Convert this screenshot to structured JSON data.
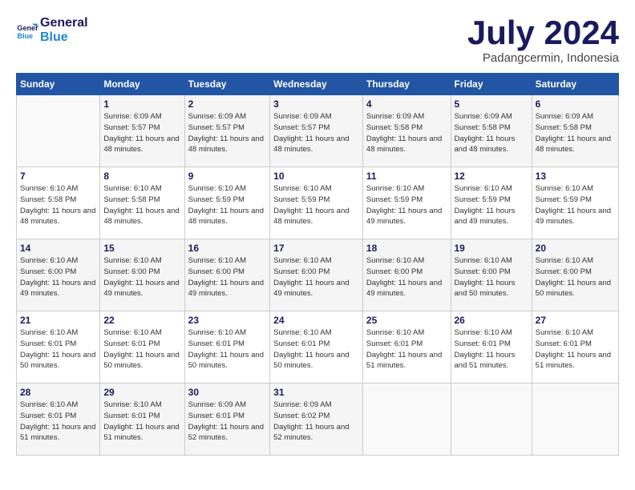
{
  "header": {
    "logo_line1": "General",
    "logo_line2": "Blue",
    "month": "July 2024",
    "location": "Padangcermin, Indonesia"
  },
  "weekdays": [
    "Sunday",
    "Monday",
    "Tuesday",
    "Wednesday",
    "Thursday",
    "Friday",
    "Saturday"
  ],
  "weeks": [
    [
      {
        "day": "",
        "sunrise": "",
        "sunset": "",
        "daylight": ""
      },
      {
        "day": "1",
        "sunrise": "6:09 AM",
        "sunset": "5:57 PM",
        "daylight": "11 hours and 48 minutes."
      },
      {
        "day": "2",
        "sunrise": "6:09 AM",
        "sunset": "5:57 PM",
        "daylight": "11 hours and 48 minutes."
      },
      {
        "day": "3",
        "sunrise": "6:09 AM",
        "sunset": "5:57 PM",
        "daylight": "11 hours and 48 minutes."
      },
      {
        "day": "4",
        "sunrise": "6:09 AM",
        "sunset": "5:58 PM",
        "daylight": "11 hours and 48 minutes."
      },
      {
        "day": "5",
        "sunrise": "6:09 AM",
        "sunset": "5:58 PM",
        "daylight": "11 hours and 48 minutes."
      },
      {
        "day": "6",
        "sunrise": "6:09 AM",
        "sunset": "5:58 PM",
        "daylight": "11 hours and 48 minutes."
      }
    ],
    [
      {
        "day": "7",
        "sunrise": "6:10 AM",
        "sunset": "5:58 PM",
        "daylight": "11 hours and 48 minutes."
      },
      {
        "day": "8",
        "sunrise": "6:10 AM",
        "sunset": "5:58 PM",
        "daylight": "11 hours and 48 minutes."
      },
      {
        "day": "9",
        "sunrise": "6:10 AM",
        "sunset": "5:59 PM",
        "daylight": "11 hours and 48 minutes."
      },
      {
        "day": "10",
        "sunrise": "6:10 AM",
        "sunset": "5:59 PM",
        "daylight": "11 hours and 48 minutes."
      },
      {
        "day": "11",
        "sunrise": "6:10 AM",
        "sunset": "5:59 PM",
        "daylight": "11 hours and 49 minutes."
      },
      {
        "day": "12",
        "sunrise": "6:10 AM",
        "sunset": "5:59 PM",
        "daylight": "11 hours and 49 minutes."
      },
      {
        "day": "13",
        "sunrise": "6:10 AM",
        "sunset": "5:59 PM",
        "daylight": "11 hours and 49 minutes."
      }
    ],
    [
      {
        "day": "14",
        "sunrise": "6:10 AM",
        "sunset": "6:00 PM",
        "daylight": "11 hours and 49 minutes."
      },
      {
        "day": "15",
        "sunrise": "6:10 AM",
        "sunset": "6:00 PM",
        "daylight": "11 hours and 49 minutes."
      },
      {
        "day": "16",
        "sunrise": "6:10 AM",
        "sunset": "6:00 PM",
        "daylight": "11 hours and 49 minutes."
      },
      {
        "day": "17",
        "sunrise": "6:10 AM",
        "sunset": "6:00 PM",
        "daylight": "11 hours and 49 minutes."
      },
      {
        "day": "18",
        "sunrise": "6:10 AM",
        "sunset": "6:00 PM",
        "daylight": "11 hours and 49 minutes."
      },
      {
        "day": "19",
        "sunrise": "6:10 AM",
        "sunset": "6:00 PM",
        "daylight": "11 hours and 50 minutes."
      },
      {
        "day": "20",
        "sunrise": "6:10 AM",
        "sunset": "6:00 PM",
        "daylight": "11 hours and 50 minutes."
      }
    ],
    [
      {
        "day": "21",
        "sunrise": "6:10 AM",
        "sunset": "6:01 PM",
        "daylight": "11 hours and 50 minutes."
      },
      {
        "day": "22",
        "sunrise": "6:10 AM",
        "sunset": "6:01 PM",
        "daylight": "11 hours and 50 minutes."
      },
      {
        "day": "23",
        "sunrise": "6:10 AM",
        "sunset": "6:01 PM",
        "daylight": "11 hours and 50 minutes."
      },
      {
        "day": "24",
        "sunrise": "6:10 AM",
        "sunset": "6:01 PM",
        "daylight": "11 hours and 50 minutes."
      },
      {
        "day": "25",
        "sunrise": "6:10 AM",
        "sunset": "6:01 PM",
        "daylight": "11 hours and 51 minutes."
      },
      {
        "day": "26",
        "sunrise": "6:10 AM",
        "sunset": "6:01 PM",
        "daylight": "11 hours and 51 minutes."
      },
      {
        "day": "27",
        "sunrise": "6:10 AM",
        "sunset": "6:01 PM",
        "daylight": "11 hours and 51 minutes."
      }
    ],
    [
      {
        "day": "28",
        "sunrise": "6:10 AM",
        "sunset": "6:01 PM",
        "daylight": "11 hours and 51 minutes."
      },
      {
        "day": "29",
        "sunrise": "6:10 AM",
        "sunset": "6:01 PM",
        "daylight": "11 hours and 51 minutes."
      },
      {
        "day": "30",
        "sunrise": "6:09 AM",
        "sunset": "6:01 PM",
        "daylight": "11 hours and 52 minutes."
      },
      {
        "day": "31",
        "sunrise": "6:09 AM",
        "sunset": "6:02 PM",
        "daylight": "11 hours and 52 minutes."
      },
      {
        "day": "",
        "sunrise": "",
        "sunset": "",
        "daylight": ""
      },
      {
        "day": "",
        "sunrise": "",
        "sunset": "",
        "daylight": ""
      },
      {
        "day": "",
        "sunrise": "",
        "sunset": "",
        "daylight": ""
      }
    ]
  ]
}
